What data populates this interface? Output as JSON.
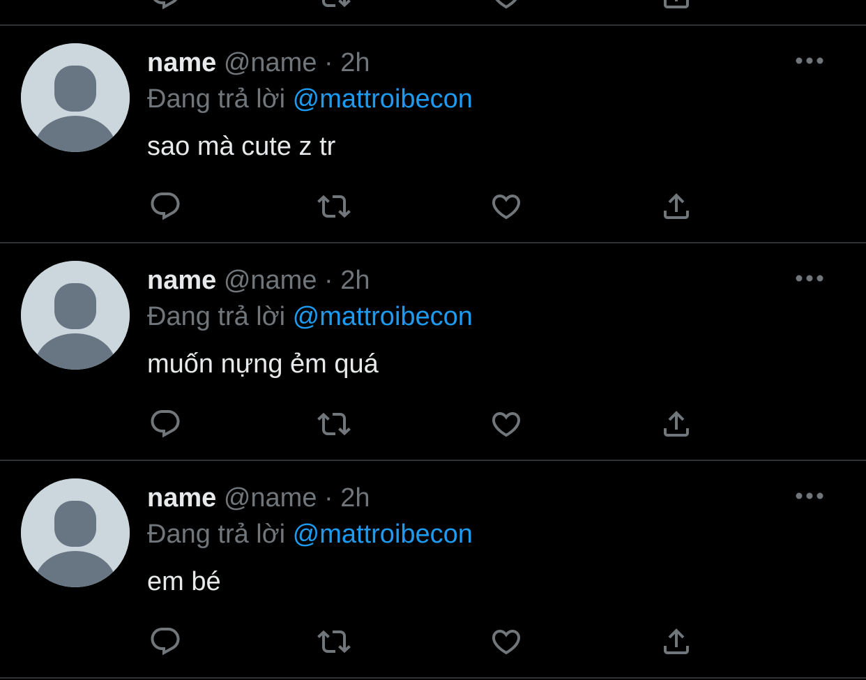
{
  "colors": {
    "background": "#000000",
    "divider": "#2f3336",
    "primary_text": "#e7e9ea",
    "secondary_text": "#71767b",
    "mention": "#1d9bf0",
    "avatar_bg": "#ccd6dd",
    "avatar_figure": "#687684"
  },
  "tweets": [
    {
      "display_name": "name",
      "handle": "@name",
      "separator": "·",
      "time": "2h",
      "replying_label": "Đang trả lời",
      "mention": "@mattroibecon",
      "text": "sao mà cute z tr",
      "icons": [
        "more-icon",
        "reply-icon",
        "retweet-icon",
        "like-icon",
        "share-icon"
      ]
    },
    {
      "display_name": "name",
      "handle": "@name",
      "separator": "·",
      "time": "2h",
      "replying_label": "Đang trả lời",
      "mention": "@mattroibecon",
      "text": "muốn nựng ẻm quá",
      "icons": [
        "more-icon",
        "reply-icon",
        "retweet-icon",
        "like-icon",
        "share-icon"
      ]
    },
    {
      "display_name": "name",
      "handle": "@name",
      "separator": "·",
      "time": "2h",
      "replying_label": "Đang trả lời",
      "mention": "@mattroibecon",
      "text": "em bé",
      "icons": [
        "more-icon",
        "reply-icon",
        "retweet-icon",
        "like-icon",
        "share-icon"
      ]
    }
  ]
}
